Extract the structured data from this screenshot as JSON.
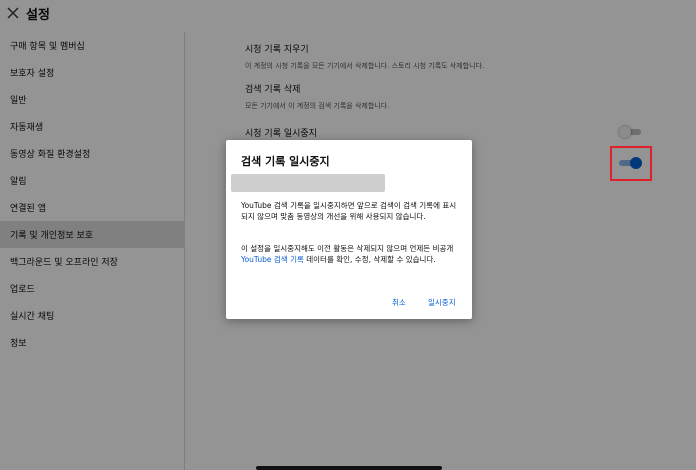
{
  "header": {
    "title": "설정",
    "close_icon": "close-icon"
  },
  "sidebar": {
    "items": [
      {
        "label": "구매 항목 및 멤버십"
      },
      {
        "label": "보호자 설정"
      },
      {
        "label": "일반"
      },
      {
        "label": "자동재생"
      },
      {
        "label": "동영상 화질 환경설정"
      },
      {
        "label": "알림"
      },
      {
        "label": "연결된 앱"
      },
      {
        "label": "기록 및 개인정보 보호"
      },
      {
        "label": "백그라운드 및 오프라인 저장"
      },
      {
        "label": "업로드"
      },
      {
        "label": "실시간 채팅"
      },
      {
        "label": "정보"
      }
    ],
    "active_index": 7
  },
  "settings": {
    "clear_watch_history": {
      "title": "시청 기록 지우기",
      "description": "이 계정의 시청 기록을 모든 기기에서 삭제합니다. 스토리 시청 기록도 삭제합니다."
    },
    "clear_search_history": {
      "title": "검색 기록 삭제",
      "description": "모든 기기에서 이 계정의 검색 기록을 삭제합니다."
    },
    "pause_watch_history": {
      "title": "시청 기록 일시중지",
      "enabled": false
    },
    "pause_search_history": {
      "enabled": true
    }
  },
  "dialog": {
    "title": "검색 기록 일시중지",
    "body1": "YouTube 검색 기록을 일시중지하면 앞으로 검색이 검색 기록에 표시되지 않으며 맞춤 동영상의 개선을 위해 사용되지 않습니다.",
    "body2_before": "이 설정을 일시중지해도 이전 활동은 삭제되지 않으며 언제든 비공개 ",
    "body2_link": "YouTube 검색 기록",
    "body2_after": " 데이터를 확인, 수정, 삭제할 수 있습니다.",
    "cancel_label": "취소",
    "pause_label": "일시중지"
  },
  "colors": {
    "accent": "#065fd4",
    "highlight": "#e0202a"
  }
}
